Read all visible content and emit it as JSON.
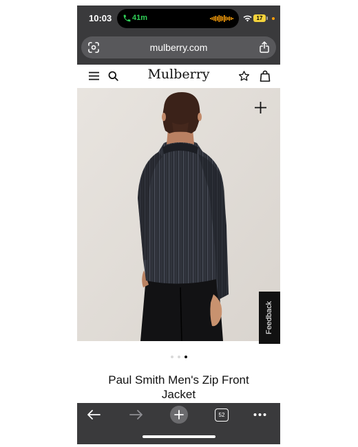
{
  "status_bar": {
    "time": "10:03",
    "call_duration": "41m",
    "battery_level": "17",
    "icons": [
      "phone-icon",
      "audio-waveform-icon",
      "wifi-icon",
      "battery-icon"
    ],
    "call_color": "#30d158",
    "battery_color": "#f5d33c"
  },
  "browser": {
    "url": "mulberry.com",
    "tab_count": "52",
    "icons": [
      "page-scan-icon",
      "share-icon",
      "back-arrow-icon",
      "forward-arrow-icon",
      "new-tab-plus-icon",
      "more-dots-icon"
    ]
  },
  "site_header": {
    "brand": "Mulberry",
    "icons": [
      "hamburger-menu-icon",
      "search-icon",
      "wishlist-star-icon",
      "shopping-bag-icon"
    ]
  },
  "product": {
    "title": "Paul Smith Men's Zip Front Jacket",
    "image_subject": "",
    "zoom_icon": "plus-icon",
    "carousel": {
      "count": 3,
      "active_index": 2
    }
  },
  "feedback": {
    "label": "Feedback"
  }
}
